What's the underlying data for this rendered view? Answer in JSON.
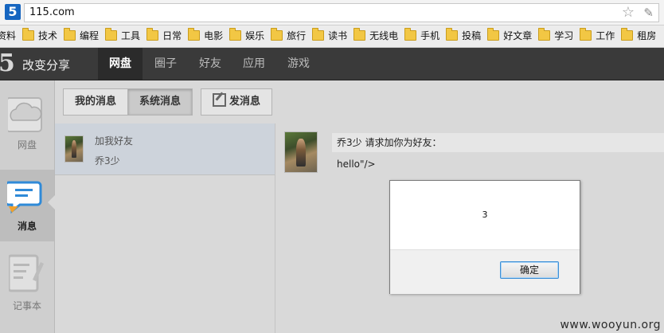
{
  "browser": {
    "favicon_glyph": "5",
    "url": "115.com",
    "bookmarks": [
      "资料",
      "技术",
      "编程",
      "工具",
      "日常",
      "电影",
      "娱乐",
      "旅行",
      "读书",
      "无线电",
      "手机",
      "投稿",
      "好文章",
      "学习",
      "工作",
      "租房"
    ]
  },
  "app": {
    "logo": "5",
    "brand": "改变分享",
    "nav": [
      "网盘",
      "圈子",
      "好友",
      "应用",
      "游戏"
    ],
    "active_nav": "网盘"
  },
  "sidebar": {
    "items": [
      {
        "label": "网盘",
        "icon": "cloud-drive-icon"
      },
      {
        "label": "消息",
        "icon": "message-icon"
      },
      {
        "label": "记事本",
        "icon": "notepad-icon"
      }
    ],
    "active": "消息"
  },
  "toolbar": {
    "my_messages": "我的消息",
    "system_messages": "系统消息",
    "compose": "发消息"
  },
  "message_list": [
    {
      "title": "加我好友",
      "sender": "乔3少"
    }
  ],
  "message_detail": {
    "header": "乔3少 请求加你为好友：",
    "body": "hello\"/>"
  },
  "dialog": {
    "message": "3",
    "ok_label": "确定"
  },
  "watermark": "www.wooyun.org",
  "colors": {
    "appbar": "#3a3a3a",
    "active_nav": "#2b2b2b",
    "message_icon_blue": "#2f8ad8",
    "message_icon_orange": "#f0a02c",
    "ok_button_border": "#3c8fd6"
  }
}
